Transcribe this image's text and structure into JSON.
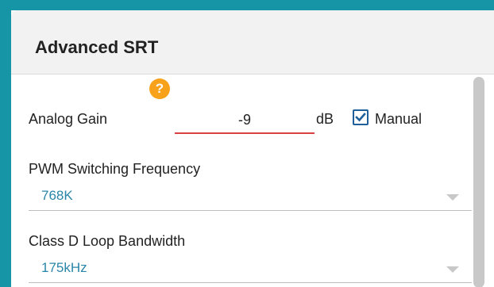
{
  "panel": {
    "title": "Advanced SRT"
  },
  "analog_gain": {
    "label": "Analog Gain",
    "help": "?",
    "value": "-9",
    "unit": "dB",
    "manual_label": "Manual",
    "manual_checked": true
  },
  "pwm": {
    "label": "PWM Switching Frequency",
    "value": "768K"
  },
  "class_d": {
    "label": "Class D Loop Bandwidth",
    "value": "175kHz"
  },
  "colors": {
    "accent": "#1595a6",
    "help_badge": "#f7a21a",
    "error_underline": "#d94040",
    "value_text": "#2a86a8",
    "checkbox": "#1f5f9a"
  }
}
